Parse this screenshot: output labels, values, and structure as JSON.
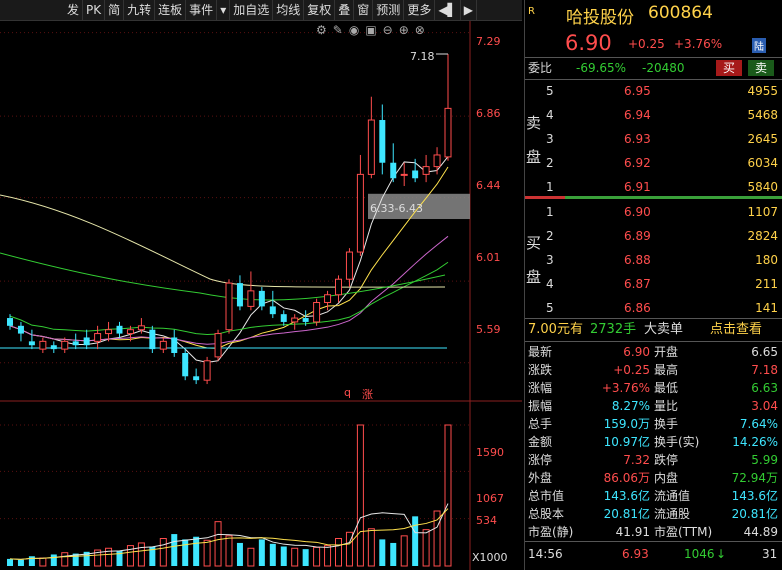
{
  "toolbar": {
    "items": [
      "发",
      "PK",
      "简",
      "九转",
      "连板",
      "事件",
      "▾",
      "加自选",
      "均线",
      "复权",
      "叠",
      "窗",
      "预测",
      "更多",
      "◀▌",
      "▶"
    ]
  },
  "chart_tools": {
    "icons": [
      "gear-icon",
      "brush-icon",
      "eye-icon",
      "screen-icon",
      "zoom-out-icon",
      "zoom-in-icon",
      "close-icon"
    ]
  },
  "price_axis": [
    "7.29",
    "6.86",
    "6.44",
    "6.01",
    "5.59"
  ],
  "volume_axis": [
    "1590",
    "1067",
    "534",
    "X1000"
  ],
  "annotations": {
    "high_label": "7.18",
    "range_label": "6.33-6.43",
    "q_mark": "q",
    "zhang_mark": "涨"
  },
  "stock": {
    "badge": "R",
    "name": "哈投股份",
    "code": "600864",
    "price": "6.90",
    "change": "+0.25",
    "change_pct": "+3.76%",
    "lu": "陆"
  },
  "order_ratio": {
    "label": "委比",
    "ratio": "-69.65%",
    "diff": "-20480",
    "buy_btn": "买",
    "sell_btn": "卖"
  },
  "sell_side": {
    "label1": "卖",
    "label2": "盘",
    "rows": [
      {
        "level": "5",
        "price": "6.95",
        "vol": "4955"
      },
      {
        "level": "4",
        "price": "6.94",
        "vol": "5468"
      },
      {
        "level": "3",
        "price": "6.93",
        "vol": "2645"
      },
      {
        "level": "2",
        "price": "6.92",
        "vol": "6034"
      },
      {
        "level": "1",
        "price": "6.91",
        "vol": "5840"
      }
    ]
  },
  "buy_side": {
    "label1": "买",
    "label2": "盘",
    "rows": [
      {
        "level": "1",
        "price": "6.90",
        "vol": "1107"
      },
      {
        "level": "2",
        "price": "6.89",
        "vol": "2824"
      },
      {
        "level": "3",
        "price": "6.88",
        "vol": "180"
      },
      {
        "level": "4",
        "price": "6.87",
        "vol": "211"
      },
      {
        "level": "5",
        "price": "6.86",
        "vol": "141"
      }
    ]
  },
  "big_order": {
    "price": "7.00元有",
    "count": "2732手",
    "label": "大卖单",
    "link": "点击查看"
  },
  "stats": [
    {
      "l1": "最新",
      "v1": "6.90",
      "c1": "red",
      "l2": "开盘",
      "v2": "6.65",
      "c2": "white"
    },
    {
      "l1": "涨跌",
      "v1": "+0.25",
      "c1": "red",
      "l2": "最高",
      "v2": "7.18",
      "c2": "red"
    },
    {
      "l1": "涨幅",
      "v1": "+3.76%",
      "c1": "red",
      "l2": "最低",
      "v2": "6.63",
      "c2": "green"
    },
    {
      "l1": "振幅",
      "v1": "8.27%",
      "c1": "cyan",
      "l2": "量比",
      "v2": "3.04",
      "c2": "red"
    },
    {
      "l1": "总手",
      "v1": "159.0万",
      "c1": "cyan",
      "l2": "换手",
      "v2": "7.64%",
      "c2": "cyan"
    },
    {
      "l1": "金额",
      "v1": "10.97亿",
      "c1": "cyan",
      "l2": "换手(实)",
      "v2": "14.26%",
      "c2": "cyan"
    },
    {
      "l1": "涨停",
      "v1": "7.32",
      "c1": "red",
      "l2": "跌停",
      "v2": "5.99",
      "c2": "green"
    },
    {
      "l1": "外盘",
      "v1": "86.06万",
      "c1": "red",
      "l2": "内盘",
      "v2": "72.94万",
      "c2": "green"
    },
    {
      "l1": "总市值",
      "v1": "143.6亿",
      "c1": "cyan",
      "l2": "流通值",
      "v2": "143.6亿",
      "c2": "cyan"
    },
    {
      "l1": "总股本",
      "v1": "20.81亿",
      "c1": "cyan",
      "l2": "流通股",
      "v2": "20.81亿",
      "c2": "cyan"
    },
    {
      "l1": "市盈(静)",
      "v1": "41.91",
      "c1": "white",
      "l2": "市盈(TTM)",
      "v2": "44.89",
      "c2": "white"
    }
  ],
  "tick": {
    "time": "14:56",
    "price": "6.93",
    "vol": "1046",
    "arrow": "↓",
    "count": "31"
  },
  "colors": {
    "up": "#ff4d4d",
    "down": "#3ee6ff",
    "ma_white": "#e6e6e6",
    "ma_yellow": "#ffe24d",
    "ma_magenta": "#cc66cc",
    "ma_green": "#33cc33",
    "ma_olive": "#e6e6aa"
  },
  "chart_data": {
    "type": "candlestick",
    "price_axis_ticks": [
      7.29,
      6.86,
      6.44,
      6.01,
      5.59
    ],
    "ylim": [
      5.47,
      7.35
    ],
    "candles": [
      {
        "o": 5.82,
        "h": 5.84,
        "l": 5.76,
        "c": 5.78
      },
      {
        "o": 5.78,
        "h": 5.8,
        "l": 5.7,
        "c": 5.74
      },
      {
        "o": 5.7,
        "h": 5.76,
        "l": 5.66,
        "c": 5.68
      },
      {
        "o": 5.66,
        "h": 5.72,
        "l": 5.64,
        "c": 5.7
      },
      {
        "o": 5.68,
        "h": 5.7,
        "l": 5.64,
        "c": 5.66
      },
      {
        "o": 5.66,
        "h": 5.72,
        "l": 5.64,
        "c": 5.7
      },
      {
        "o": 5.7,
        "h": 5.74,
        "l": 5.66,
        "c": 5.68
      },
      {
        "o": 5.72,
        "h": 5.76,
        "l": 5.66,
        "c": 5.68
      },
      {
        "o": 5.7,
        "h": 5.78,
        "l": 5.66,
        "c": 5.74
      },
      {
        "o": 5.74,
        "h": 5.8,
        "l": 5.7,
        "c": 5.76
      },
      {
        "o": 5.78,
        "h": 5.8,
        "l": 5.72,
        "c": 5.74
      },
      {
        "o": 5.74,
        "h": 5.78,
        "l": 5.7,
        "c": 5.76
      },
      {
        "o": 5.76,
        "h": 5.82,
        "l": 5.74,
        "c": 5.78
      },
      {
        "o": 5.76,
        "h": 5.78,
        "l": 5.64,
        "c": 5.66
      },
      {
        "o": 5.66,
        "h": 5.72,
        "l": 5.64,
        "c": 5.7
      },
      {
        "o": 5.72,
        "h": 5.76,
        "l": 5.62,
        "c": 5.64
      },
      {
        "o": 5.64,
        "h": 5.66,
        "l": 5.5,
        "c": 5.52
      },
      {
        "o": 5.52,
        "h": 5.56,
        "l": 5.48,
        "c": 5.5
      },
      {
        "o": 5.5,
        "h": 5.62,
        "l": 5.48,
        "c": 5.6
      },
      {
        "o": 5.62,
        "h": 5.76,
        "l": 5.6,
        "c": 5.74
      },
      {
        "o": 5.76,
        "h": 6.02,
        "l": 5.74,
        "c": 6.0
      },
      {
        "o": 6.0,
        "h": 6.04,
        "l": 5.86,
        "c": 5.88
      },
      {
        "o": 5.88,
        "h": 6.06,
        "l": 5.86,
        "c": 5.96
      },
      {
        "o": 5.96,
        "h": 5.98,
        "l": 5.86,
        "c": 5.88
      },
      {
        "o": 5.88,
        "h": 5.96,
        "l": 5.82,
        "c": 5.84
      },
      {
        "o": 5.84,
        "h": 5.86,
        "l": 5.78,
        "c": 5.8
      },
      {
        "o": 5.8,
        "h": 5.84,
        "l": 5.76,
        "c": 5.82
      },
      {
        "o": 5.82,
        "h": 5.86,
        "l": 5.78,
        "c": 5.8
      },
      {
        "o": 5.8,
        "h": 5.92,
        "l": 5.78,
        "c": 5.9
      },
      {
        "o": 5.9,
        "h": 5.96,
        "l": 5.86,
        "c": 5.94
      },
      {
        "o": 5.94,
        "h": 6.04,
        "l": 5.9,
        "c": 6.02
      },
      {
        "o": 6.02,
        "h": 6.18,
        "l": 5.98,
        "c": 6.16
      },
      {
        "o": 6.16,
        "h": 6.66,
        "l": 6.14,
        "c": 6.56
      },
      {
        "o": 6.56,
        "h": 6.96,
        "l": 6.54,
        "c": 6.84
      },
      {
        "o": 6.84,
        "h": 6.92,
        "l": 6.56,
        "c": 6.62
      },
      {
        "o": 6.62,
        "h": 6.72,
        "l": 6.52,
        "c": 6.54
      },
      {
        "o": 6.56,
        "h": 6.62,
        "l": 6.5,
        "c": 6.56
      },
      {
        "o": 6.58,
        "h": 6.64,
        "l": 6.52,
        "c": 6.54
      },
      {
        "o": 6.56,
        "h": 6.66,
        "l": 6.52,
        "c": 6.6
      },
      {
        "o": 6.6,
        "h": 6.7,
        "l": 6.56,
        "c": 6.66
      },
      {
        "o": 6.65,
        "h": 7.18,
        "l": 6.63,
        "c": 6.9
      }
    ],
    "volumes": [
      80,
      70,
      110,
      90,
      130,
      150,
      140,
      160,
      180,
      200,
      170,
      230,
      260,
      220,
      310,
      360,
      300,
      330,
      290,
      500,
      340,
      260,
      200,
      300,
      250,
      220,
      200,
      190,
      210,
      230,
      310,
      380,
      1590,
      420,
      300,
      260,
      340,
      560,
      410,
      620,
      1590
    ],
    "volume_axis_ticks": [
      1590,
      1067,
      534
    ]
  }
}
